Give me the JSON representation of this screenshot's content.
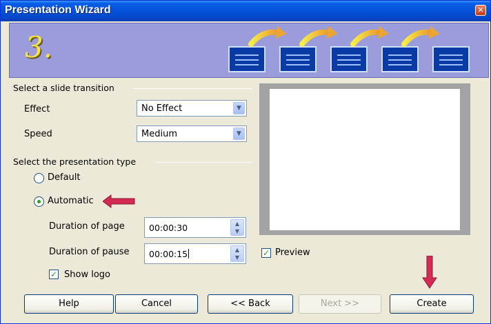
{
  "window": {
    "title": "Presentation Wizard",
    "close_glyph": "✕"
  },
  "banner": {
    "step": "3."
  },
  "transition": {
    "section_label": "Select a slide transition",
    "effect_label": "Effect",
    "effect_value": "No Effect",
    "speed_label": "Speed",
    "speed_value": "Medium"
  },
  "presentation_type": {
    "section_label": "Select the presentation type",
    "default_label": "Default",
    "automatic_label": "Automatic",
    "selected": "Automatic",
    "duration_page_label": "Duration of page",
    "duration_page_value": "00:00:30",
    "duration_pause_label": "Duration of pause",
    "duration_pause_value": "00:00:15",
    "show_logo_label": "Show logo",
    "show_logo_checked": true
  },
  "preview": {
    "label": "Preview",
    "checked": true
  },
  "buttons": {
    "help": "Help",
    "cancel": "Cancel",
    "back": "<< Back",
    "next": "Next >>",
    "create": "Create"
  },
  "icons": {
    "dropdown": "▼",
    "spin_up": "▲",
    "spin_down": "▼",
    "check": "✓"
  },
  "colors": {
    "titlebar": "#0553dc",
    "banner": "#9a9cdc",
    "annotation_arrow": "#d42a52"
  }
}
